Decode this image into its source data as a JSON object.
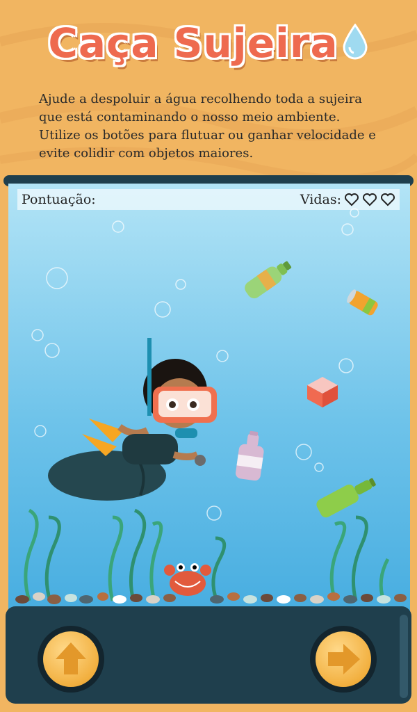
{
  "game": {
    "title": "Caça Sujeira",
    "intro_text": "Ajude a despoluir a água recolhendo toda a sujeira que está contaminando o nosso meio ambiente. Utilize os botões para flutuar ou ganhar velocidade e evite colidir com objetos maiores."
  },
  "hud": {
    "score_label": "Pontuação:",
    "lives_label": "Vidas:",
    "lives_remaining": 3
  },
  "controls": {
    "up_icon": "arrow-up-icon",
    "right_icon": "arrow-right-icon"
  },
  "colors": {
    "title": "#ee6a4f",
    "sand": "#f1b561",
    "panel": "#1f3f4d",
    "button": "#f2b040"
  }
}
